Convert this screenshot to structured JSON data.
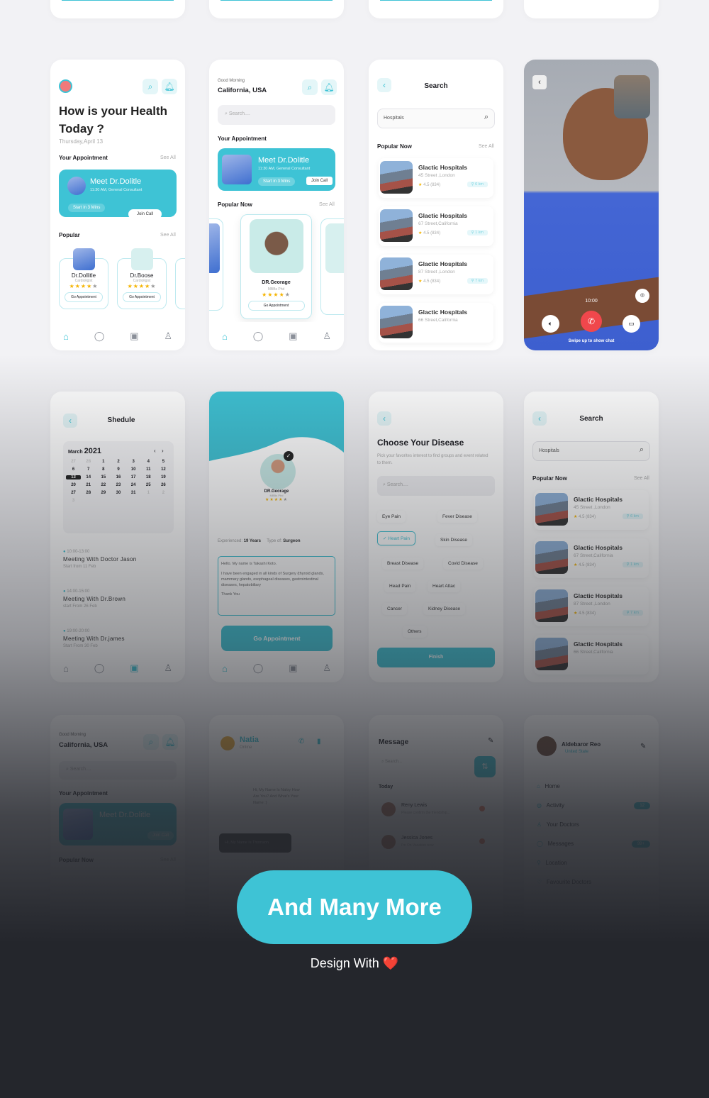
{
  "colors": {
    "accent": "#3ec3d5",
    "background": "#f2f2f5",
    "dark": "#24262c",
    "call_end": "#f0474c"
  },
  "nav_icons": [
    "home-icon",
    "chat-icon",
    "calendar-icon",
    "profile-icon"
  ],
  "home1": {
    "title_line1": "How is your Health",
    "title_line2": "Today ?",
    "date": "Thursday,April 13",
    "appointment_label": "Your Appointment",
    "see_all": "See All",
    "appointment": {
      "doctor": "Meet Dr.Dolitle",
      "time": "11:30 AM, General Consultant",
      "start": "Start in 3 Mins",
      "join": "Join Call"
    },
    "popular_label": "Popular",
    "doctors": [
      {
        "name": "Dr.Dollitle",
        "role": "Cardioligist",
        "rating": 4,
        "action": "Go Appointment"
      },
      {
        "name": "Dr.Boose",
        "role": "Cardioligist",
        "rating": 4,
        "action": "Go Appointment"
      }
    ]
  },
  "home2": {
    "greeting": "Good Morning",
    "location": "California, USA",
    "search_placeholder": "Search....",
    "appointment_label": "Your Appointment",
    "appointment": {
      "doctor": "Meet Dr.Dolitle",
      "time": "11:30 AM, General Consultant",
      "start": "Start in 3 Mins",
      "join": "Join Call"
    },
    "popular_label": "Popular Now",
    "see_all": "See All",
    "doctor": {
      "name": "DR.Georage",
      "degree": "MBBs Phd",
      "rating": 4,
      "action": "Go Appointment"
    }
  },
  "search": {
    "title": "Search",
    "query": "Hospitals",
    "popular_label": "Popular Now",
    "see_all": "See All",
    "hospitals": [
      {
        "name": "Glactic Hospitals",
        "address": "45 Street ,London",
        "rating": "4.5 (834)",
        "distance": "6 km"
      },
      {
        "name": "Glactic Hospitals",
        "address": "67 Street,California",
        "rating": "4.5 (834)",
        "distance": "1 km"
      },
      {
        "name": "Glactic Hospitals",
        "address": "87 Street ,London",
        "rating": "4.5 (834)",
        "distance": "7 km"
      },
      {
        "name": "Glactic Hospitals",
        "address": "66 Street,California",
        "rating": "",
        "distance": ""
      }
    ]
  },
  "call": {
    "timer": "10:00",
    "hint": "Swipe up to show chat"
  },
  "schedule": {
    "title": "Shedule",
    "month": "March",
    "year": "2021",
    "selected": 13,
    "days": [
      "27",
      "28",
      "1",
      "2",
      "3",
      "4",
      "5",
      "6",
      "7",
      "8",
      "9",
      "10",
      "11",
      "12",
      "13",
      "14",
      "15",
      "16",
      "17",
      "18",
      "19",
      "20",
      "21",
      "22",
      "23",
      "24",
      "25",
      "26",
      "27",
      "28",
      "29",
      "30",
      "31",
      "1",
      "2",
      "3"
    ],
    "meetings": [
      {
        "time": "10:00-13:00",
        "title": "Meeting With Doctor Jason",
        "start": "Start from 11 Feb"
      },
      {
        "time": "14:00-15:00",
        "title": "Meeting With Dr.Brown",
        "start": "start From 26 Feb"
      },
      {
        "time": "19:00-20:00",
        "title": "Meeting With Dr.james",
        "start": "Start From 30 Feb"
      }
    ]
  },
  "profile": {
    "name": "DR.Georage",
    "degree": "MBBs Phd",
    "rating": 4,
    "experience_label": "Experienced:",
    "experience": "19 Years",
    "type_label": "Type of:",
    "type": "Surgeon",
    "bio_greeting": "Hello. My name is Takashi Koto.",
    "bio": "I have been engaged in all kinds of Surgery (thyroid glands, mammary glands, esophageal diseases, gastrointestinal diseases, hepatobiliary",
    "bio_thanks": "Thank You",
    "action": "Go Appointment"
  },
  "disease": {
    "title": "Choose Your Disease",
    "subtitle": "Pick your favorites interest to find groups and event related to them.",
    "search_placeholder": "Search....",
    "chips": [
      "Eye Pain",
      "Fever Disease",
      "Heart Pain",
      "Skin Disease",
      "Breast Disease",
      "Covid Disease",
      "Head Pain",
      "Heart Attac",
      "Cancer",
      "Kidney Disease",
      "Others"
    ],
    "selected": "Heart Pain",
    "finish": "Finish"
  },
  "home3": {
    "greeting": "Good Morning",
    "location": "California, USA",
    "search_placeholder": "Search....",
    "appointment_label": "Your Appointment",
    "doctor": "Meet Dr.Dolitle",
    "join": "Join Call",
    "popular_label": "Popular Now",
    "see_all": "See All"
  },
  "chat": {
    "name": "Natia",
    "status": "Online",
    "incoming": "Hi, My Name Is Naloy How Are You? And What's Your Name :)",
    "outgoing": "Hi, My Name Is Thomson"
  },
  "messages": {
    "title": "Message",
    "search_placeholder": "Search...",
    "today": "Today",
    "items": [
      {
        "name": "Reny Lewis",
        "preview": "Please confirm the friendship..."
      },
      {
        "name": "Jessica Jones",
        "preview": "I'm On Vacation now"
      }
    ]
  },
  "menu": {
    "name": "Aldebaror Reo",
    "country": "United State",
    "items": [
      {
        "label": "Home",
        "badge": ""
      },
      {
        "label": "Activity",
        "badge": "12"
      },
      {
        "label": "Your Doctors",
        "badge": ""
      },
      {
        "label": "Messages",
        "badge": "99+"
      },
      {
        "label": "Location",
        "badge": ""
      },
      {
        "label": "Favourite Doctors",
        "badge": ""
      }
    ]
  },
  "footer": {
    "cta": "And Many More",
    "tagline": "Design With",
    "heart": "❤️"
  }
}
